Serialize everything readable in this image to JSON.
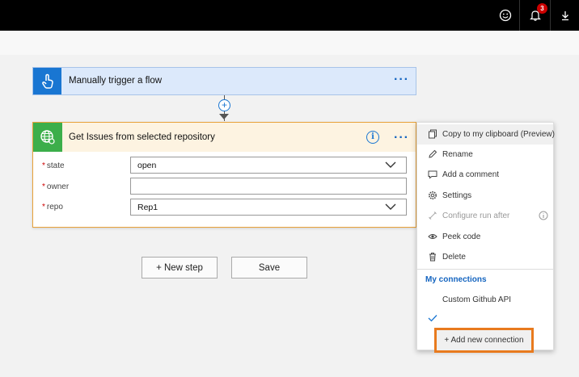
{
  "topbar": {
    "notification_count": "3"
  },
  "trigger_card": {
    "title": "Manually trigger a flow",
    "menu_dots": "···"
  },
  "action_card": {
    "title": "Get Issues from selected repository",
    "menu_dots": "···",
    "info_glyph": "i",
    "required_marker": "*",
    "fields": [
      {
        "label": "state",
        "value": "open",
        "type": "dropdown"
      },
      {
        "label": "owner",
        "value": "",
        "type": "text"
      },
      {
        "label": "repo",
        "value": "Rep1",
        "type": "dropdown"
      }
    ]
  },
  "buttons": {
    "new_step": "+ New step",
    "save": "Save"
  },
  "context_menu": {
    "items": [
      {
        "label": "Copy to my clipboard (Preview)",
        "icon": "copy-icon"
      },
      {
        "label": "Rename",
        "icon": "pencil-icon"
      },
      {
        "label": "Add a comment",
        "icon": "comment-icon"
      },
      {
        "label": "Settings",
        "icon": "gear-icon"
      },
      {
        "label": "Configure run after",
        "icon": "link-icon",
        "disabled": true
      },
      {
        "label": "Peek code",
        "icon": "eye-icon"
      },
      {
        "label": "Delete",
        "icon": "trash-icon"
      }
    ],
    "connections_heading": "My connections",
    "connection_name": "Custom Github API",
    "add_connection": "+ Add new connection"
  }
}
